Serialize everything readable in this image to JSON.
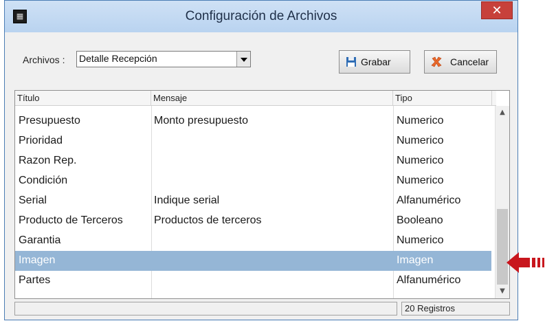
{
  "window": {
    "title": "Configuración de Archivos",
    "close_label": "✕"
  },
  "archivos": {
    "label": "Archivos :",
    "value": "Detalle Recepción"
  },
  "buttons": {
    "save_label": "Grabar",
    "cancel_label": "Cancelar"
  },
  "table": {
    "columns": [
      "Título",
      "Mensaje",
      "Tipo"
    ],
    "rows": [
      {
        "titulo": "Presupuesto",
        "mensaje": "Monto presupuesto",
        "tipo": "Numerico"
      },
      {
        "titulo": "Prioridad",
        "mensaje": "",
        "tipo": "Numerico"
      },
      {
        "titulo": "Razon Rep.",
        "mensaje": "",
        "tipo": "Numerico"
      },
      {
        "titulo": "Condición",
        "mensaje": "",
        "tipo": "Numerico"
      },
      {
        "titulo": "Serial",
        "mensaje": "Indique serial",
        "tipo": "Alfanumérico"
      },
      {
        "titulo": "Producto de Terceros",
        "mensaje": "Productos de terceros",
        "tipo": "Booleano"
      },
      {
        "titulo": "Garantia",
        "mensaje": "",
        "tipo": "Numerico"
      },
      {
        "titulo": "Imagen",
        "mensaje": "",
        "tipo": "Imagen"
      },
      {
        "titulo": "Partes",
        "mensaje": "",
        "tipo": "Alfanumérico"
      }
    ],
    "selected_row": 7
  },
  "status": {
    "left": "",
    "records": "20 Registros"
  },
  "colors": {
    "selection": "#95b6d6",
    "close": "#c7413b",
    "annotation_arrow": "#c8161d"
  }
}
